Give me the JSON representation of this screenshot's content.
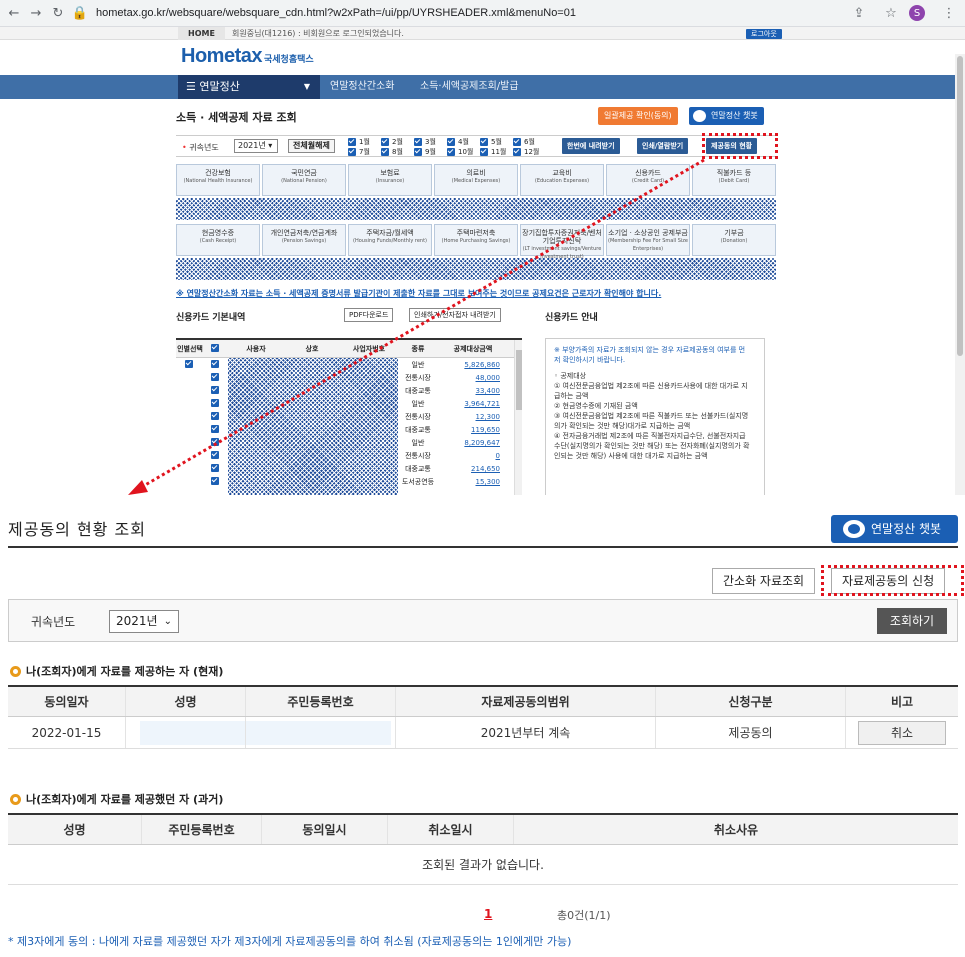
{
  "browser": {
    "url": "hometax.go.kr/websquare/websquare_cdn.html?w2xPath=/ui/pp/UYRSHEADER.xml&menuNo=01",
    "profile_initial": "S"
  },
  "site": {
    "home_tab": "HOME",
    "util_text": "회원중님(대1216) : 비회원으로 로그인되었습니다.",
    "logout": "로그아웃",
    "logo_main": "Hometax",
    "logo_sub": "국세청홈택스",
    "gnb_first": "연말정산",
    "gnb_items": [
      "연말정산간소화",
      "소득·세액공제조회/발급"
    ]
  },
  "top_page": {
    "title": "소득 · 세액공제 자료 조회",
    "btn_orange": "일괄제공 확인(동의)",
    "btn_chatbot": "연말정산 챗봇",
    "filter": {
      "label": "귀속년도",
      "year": "2021년",
      "select_all": "전체월해제",
      "months": [
        "1월",
        "2월",
        "3월",
        "4월",
        "5월",
        "6월",
        "7월",
        "8월",
        "9월",
        "10월",
        "11월",
        "12월"
      ],
      "btn_download": "한번에 내려받기",
      "btn_print": "인쇄/열람받기",
      "btn_consent_status": "제공동의 현황"
    },
    "categories_row1": [
      {
        "ko": "건강보험",
        "en": "(National Health Insurance)"
      },
      {
        "ko": "국민연금",
        "en": "(National Pension)"
      },
      {
        "ko": "보험료",
        "en": "(Insurance)"
      },
      {
        "ko": "의료비",
        "en": "(Medical Expenses)"
      },
      {
        "ko": "교육비",
        "en": "(Education Expenses)"
      },
      {
        "ko": "신용카드",
        "en": "(Credit Card)"
      },
      {
        "ko": "직불카드 등",
        "en": "(Debit Card)"
      }
    ],
    "categories_row2": [
      {
        "ko": "현금영수증",
        "en": "(Cash Receipt)"
      },
      {
        "ko": "개인연금저축/연금계좌",
        "en": "(Pension Savings)"
      },
      {
        "ko": "주택자금/월세액",
        "en": "(Housing Funds/Monthly rent)"
      },
      {
        "ko": "주택마련저축",
        "en": "(Home Purchasing Savings)"
      },
      {
        "ko": "장기집합투자증권저축/벤처기업투자신탁",
        "en": "(LT investment savings/Venture investment trust)"
      },
      {
        "ko": "소기업 · 소상공인 공제부금",
        "en": "(Membership Fee For Small Size Enterprises)"
      },
      {
        "ko": "기부금",
        "en": "(Donation)"
      }
    ],
    "notice": "※ 연말정산간소화 자료는 소득 · 세액공제 증명서류 발급기관이 제출한 자료를 그대로 보여주는 것이므로 공제요건은 근로자가 확인해야 합니다.",
    "card_section": {
      "title": "신용카드 기본내역",
      "btn_pdf": "PDF다운로드",
      "btn_print": "인쇄하기/전자접자 내려받기",
      "headers": [
        "인별선택",
        "",
        "사용자",
        "상호",
        "사업자번호",
        "종류",
        "공제대상금액"
      ],
      "rows": [
        {
          "type": "일반",
          "amount": "5,826,860"
        },
        {
          "type": "전통시장",
          "amount": "48,000"
        },
        {
          "type": "대중교통",
          "amount": "33,400"
        },
        {
          "type": "일반",
          "amount": "3,964,721"
        },
        {
          "type": "전통시장",
          "amount": "12,300"
        },
        {
          "type": "대중교통",
          "amount": "119,650"
        },
        {
          "type": "일반",
          "amount": "8,209,647"
        },
        {
          "type": "전통시장",
          "amount": "0"
        },
        {
          "type": "대중교통",
          "amount": "214,650"
        },
        {
          "type": "도서공연등",
          "amount": "15,300"
        }
      ]
    },
    "guide": {
      "title": "신용카드 안내",
      "intro": "※ 부양가족의 자료가 조회되지 않는 경우 자료제공동의 여부를 먼저 확인하시기 바랍니다.",
      "lines": [
        "◦ 공제대상",
        "① 여신전문금융업법 제2조에 따른 신용카드사용에 대한 대가로 지급하는 금액",
        "② 현금영수증에 기재된 금액",
        "③ 여신전문금융업법 제2조에 따른 직불카드 또는 선불카드(실지명의가 확인되는 것만 해당)대가로 지급하는 금액",
        "④ 전자금융거래법 제2조에 따른 직불전자지급수단, 선불전자지급수단(실지명의가 확인되는 것만 해당) 또는 전자화폐(실지명의가 확인되는 것만 해당) 사용에 대한 대가로 지급하는 금액"
      ]
    }
  },
  "consent_page": {
    "title": "제공동의 현황 조회",
    "chatbot": "연말정산 챗봇",
    "btn_simple": "간소화 자료조회",
    "btn_apply": "자료제공동의 신청",
    "search": {
      "label": "귀속년도",
      "year": "2021년",
      "btn": "조회하기"
    },
    "current": {
      "title": "나(조회자)에게 자료를 제공하는 자 (현재)",
      "headers": [
        "동의일자",
        "성명",
        "주민등록번호",
        "자료제공동의범위",
        "신청구분",
        "비고"
      ],
      "rows": [
        {
          "date": "2022-01-15",
          "name": "",
          "rrn": "",
          "scope": "2021년부터 계속",
          "kind": "제공동의",
          "action": "취소"
        }
      ]
    },
    "past": {
      "title": "나(조회자)에게 자료를 제공했던 자 (과거)",
      "headers": [
        "성명",
        "주민등록번호",
        "동의일시",
        "취소일시",
        "취소사유"
      ],
      "empty": "조회된 결과가 없습니다."
    },
    "pager": "1",
    "total": "총0건(1/1)",
    "footnote": "* 제3자에게 동의 : 나에게 자료를 제공했던 자가 제3자에게 자료제공동의를 하여 취소됨 (자료제공동의는 1인에게만 가능)"
  },
  "colors": {
    "accent_blue": "#1b5fb4",
    "navy": "#1e3b6b",
    "annotation_red": "#e0141e",
    "orange": "#f07a32"
  }
}
